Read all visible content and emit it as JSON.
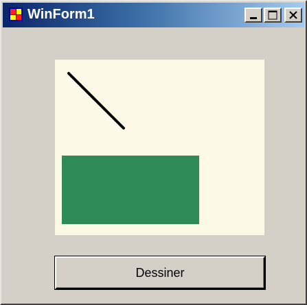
{
  "window": {
    "title": "WinForm1",
    "controls": {
      "minimize": "minimize-icon",
      "maximize": "maximize-icon",
      "close": "close-icon"
    }
  },
  "canvas": {
    "background": "#fcfae6",
    "line_color": "#000000",
    "rect_color": "#2e8b57"
  },
  "button": {
    "label": "Dessiner"
  }
}
